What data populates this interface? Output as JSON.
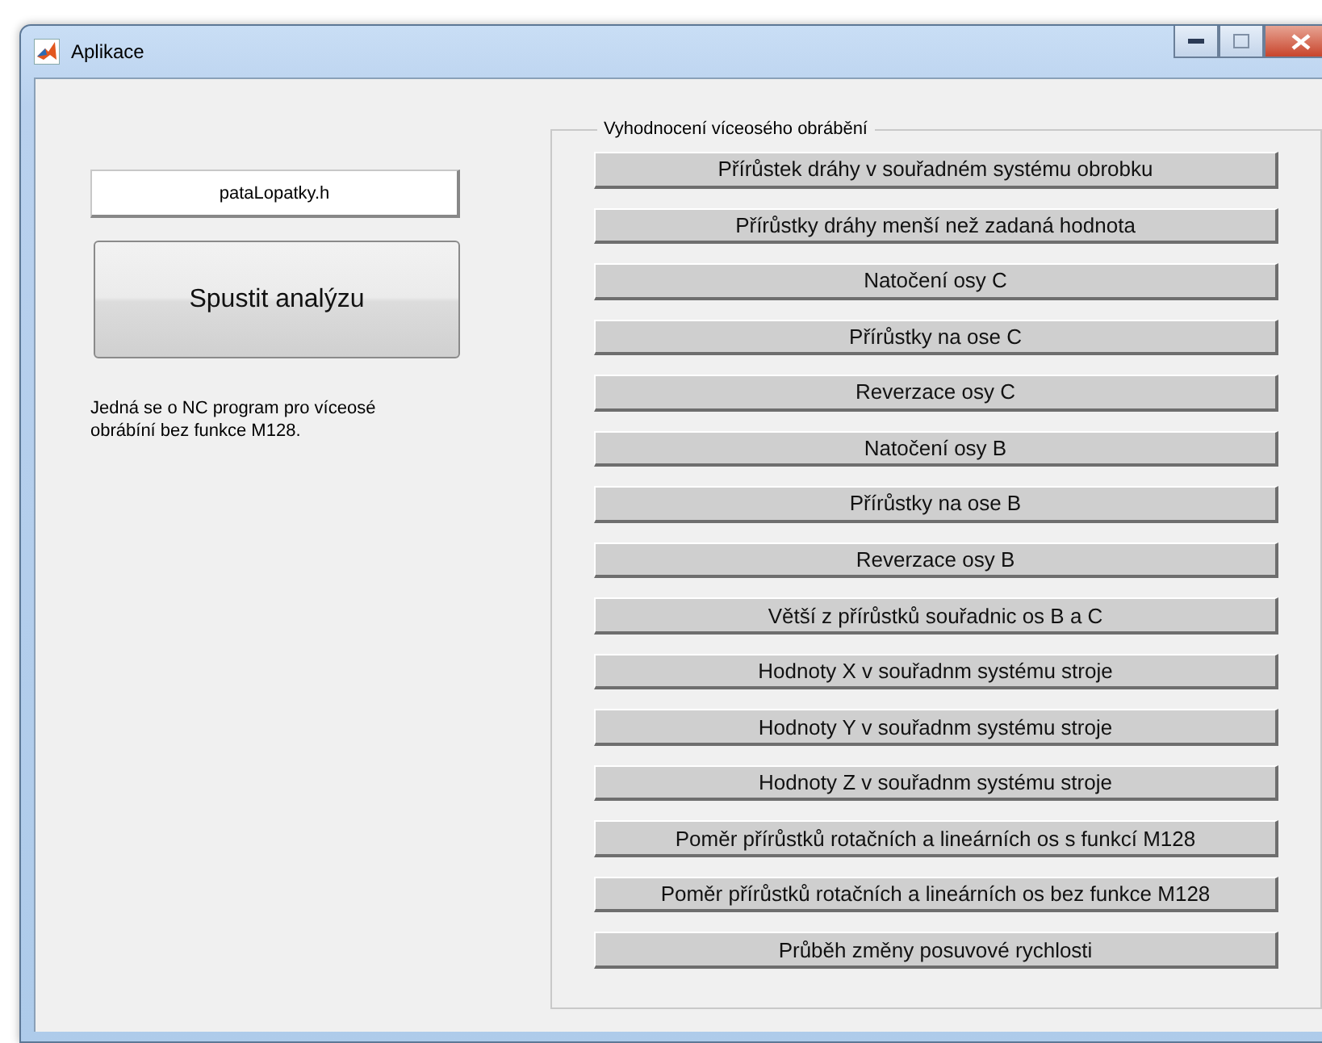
{
  "window": {
    "title": "Aplikace"
  },
  "file_field": {
    "value": "pataLopatky.h"
  },
  "run_button": {
    "label": "Spustit analýzu"
  },
  "info_text": "Jedná se o NC program pro víceosé obrábíní bez funkce M128.",
  "panel": {
    "title": "Vyhodnocení víceosého obrábění",
    "buttons": [
      "Přírůstek dráhy v souřadném systému obrobku",
      "Přírůstky dráhy menší než zadaná hodnota",
      "Natočení osy C",
      "Přírůstky na ose C",
      "Reverzace osy C",
      "Natočení osy B",
      "Přírůstky na ose B",
      "Reverzace osy B",
      "Větší z přírůstků souřadnic os B a C",
      "Hodnoty X v souřadnm systému stroje",
      "Hodnoty Y v souřadnm systému stroje",
      "Hodnoty Z v souřadnm systému stroje",
      "Poměr přírůstků rotačních a lineárních os s funkcí M128",
      "Poměr přírůstků rotačních a lineárních os bez funkce M128",
      "Průběh změny posuvové rychlosti"
    ]
  }
}
